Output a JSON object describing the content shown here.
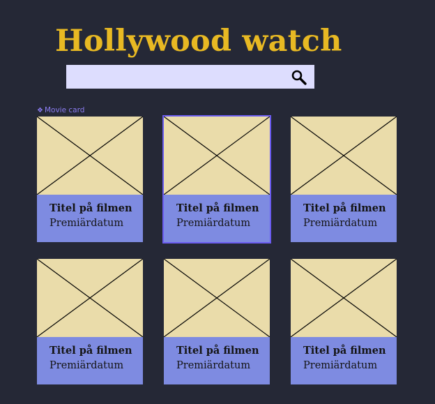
{
  "header": {
    "title": "Hollywood watch"
  },
  "search": {
    "value": "",
    "placeholder": "",
    "icon": "search-icon"
  },
  "component_label": {
    "icon": "component-diamond-icon",
    "text": "Movie card"
  },
  "colors": {
    "background": "#252836",
    "title": "#E8B923",
    "search_bar": "#DDDDFE",
    "poster_placeholder": "#EADCAA",
    "card_info": "#7E8BE1",
    "selection_outline": "#6B5CF0"
  },
  "movies": [
    {
      "title": "Titel på filmen",
      "date": "Premiärdatum",
      "poster": "image-placeholder-icon",
      "selected": false
    },
    {
      "title": "Titel på filmen",
      "date": "Premiärdatum",
      "poster": "image-placeholder-icon",
      "selected": true
    },
    {
      "title": "Titel på filmen",
      "date": "Premiärdatum",
      "poster": "image-placeholder-icon",
      "selected": false
    },
    {
      "title": "Titel på filmen",
      "date": "Premiärdatum",
      "poster": "image-placeholder-icon",
      "selected": false
    },
    {
      "title": "Titel på filmen",
      "date": "Premiärdatum",
      "poster": "image-placeholder-icon",
      "selected": false
    },
    {
      "title": "Titel på filmen",
      "date": "Premiärdatum",
      "poster": "image-placeholder-icon",
      "selected": false
    }
  ]
}
